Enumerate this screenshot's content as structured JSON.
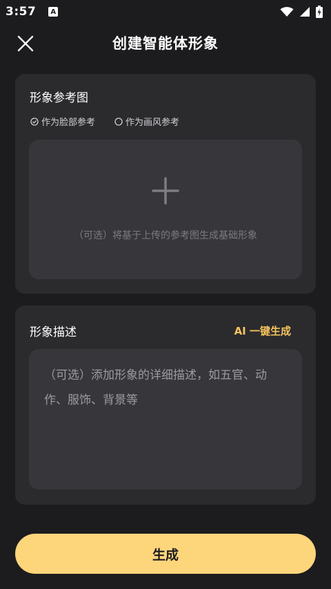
{
  "status_bar": {
    "time": "3:57",
    "notification_badge": "A",
    "icons": [
      "wifi-icon",
      "signal-icon",
      "battery-icon"
    ]
  },
  "header": {
    "title": "创建智能体形象",
    "close_icon": "close-icon"
  },
  "reference_card": {
    "title": "形象参考图",
    "options": [
      {
        "label": "作为脸部参考",
        "selected": true
      },
      {
        "label": "作为画风参考",
        "selected": false
      }
    ],
    "upload_hint": "（可选）将基于上传的参考图生成基础形象",
    "upload_icon": "plus-icon"
  },
  "description_card": {
    "title": "形象描述",
    "ai_button": "AI 一键生成",
    "placeholder": "（可选）添加形象的详细描述，如五官、动作、服饰、背景等"
  },
  "footer": {
    "generate_label": "生成"
  },
  "colors": {
    "background": "#1c1c1e",
    "card": "#2b2b2e",
    "input": "#37373b",
    "accent": "#f5c45e",
    "primary_button": "#fdd57b"
  }
}
